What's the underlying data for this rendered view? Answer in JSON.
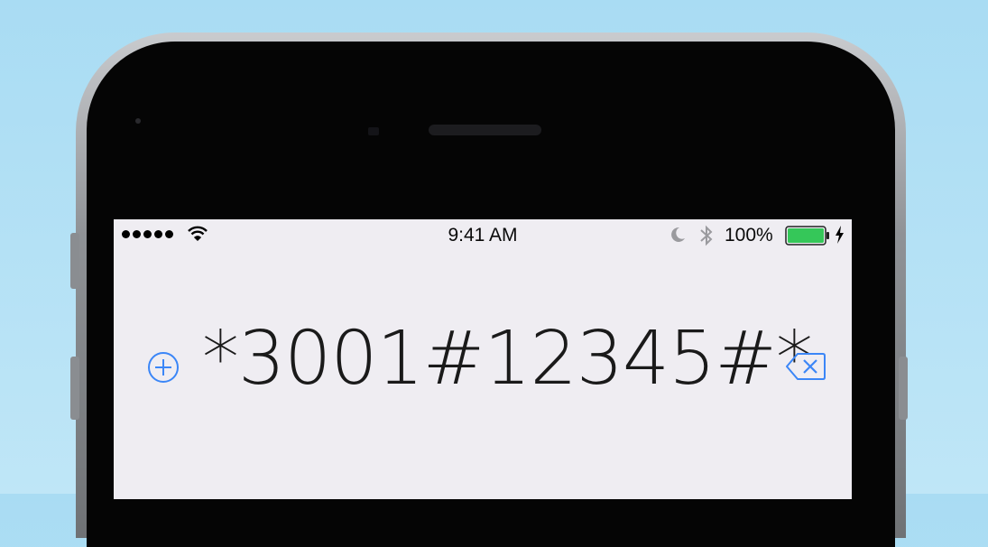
{
  "status_bar": {
    "time": "9:41 AM",
    "battery_percent_label": "100%",
    "battery_level": 1.0,
    "signal_bars_filled": 5,
    "icons": [
      "wifi-icon",
      "moon-icon",
      "bluetooth-icon",
      "battery-icon",
      "charging-bolt-icon"
    ]
  },
  "dialer": {
    "number": "*3001#12345#*",
    "add_icon": "add-contact-icon",
    "delete_icon": "delete-backspace-icon"
  },
  "colors": {
    "accent": "#3b86f7",
    "battery_fill": "#35c759",
    "screen_bg": "#efedf2",
    "background": "#b3e0f5"
  }
}
